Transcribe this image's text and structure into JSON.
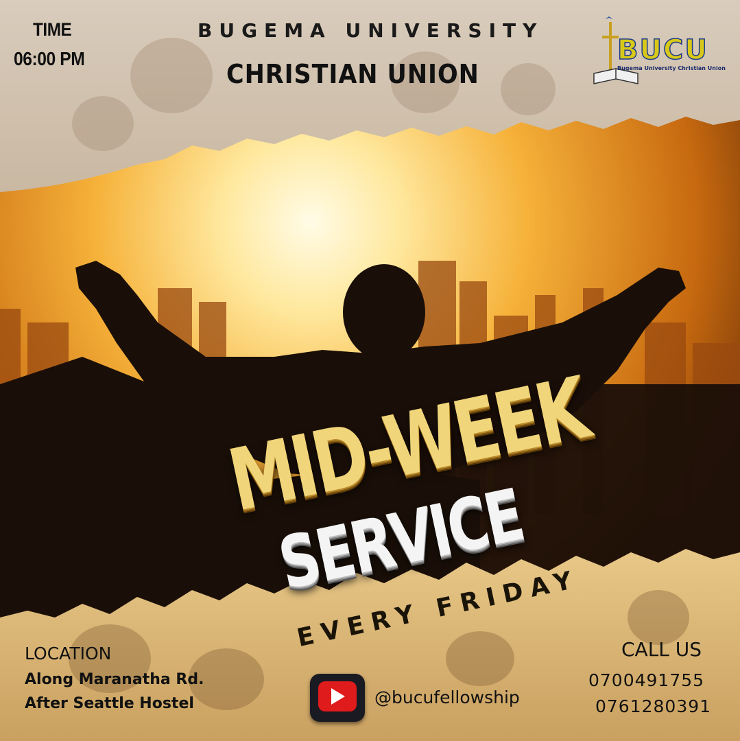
{
  "header": {
    "time_label": "TIME",
    "time_value": "06:00 PM",
    "university": "BUGEMA UNIVERSITY",
    "union": "CHRISTIAN UNION"
  },
  "logo": {
    "text": "BUCU",
    "subtitle": "Bugema University Christian Union"
  },
  "event": {
    "title_line1": "MID-WEEK",
    "title_line2": "SERVICE",
    "schedule": "EVERY FRIDAY"
  },
  "location": {
    "label": "LOCATION",
    "line1": "Along Maranatha Rd.",
    "line2": "After Seattle Hostel"
  },
  "social": {
    "icon": "youtube-icon",
    "handle": "@bucufellowship"
  },
  "contact": {
    "label": "CALL US",
    "phones": [
      "0700491755",
      "0761280391"
    ]
  },
  "colors": {
    "sky_orange": "#f0a020",
    "sun": "#fff6d0",
    "silhouette": "#1a0f08",
    "title_gold": "#f0d57a",
    "youtube_red": "#e01b1b"
  }
}
